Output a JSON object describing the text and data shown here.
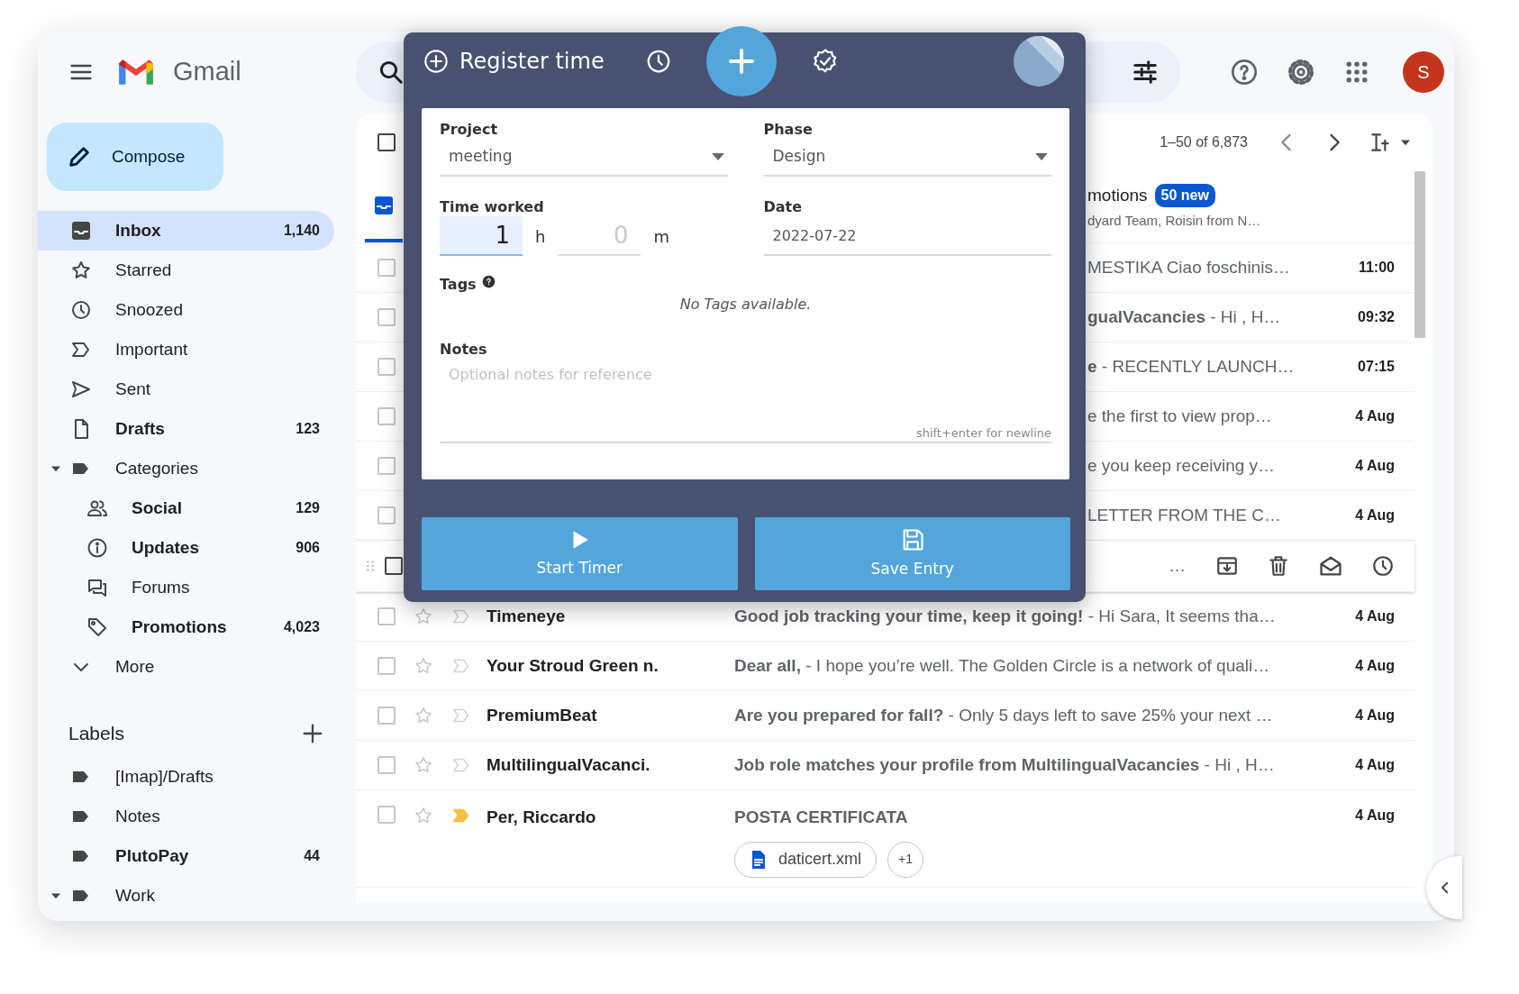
{
  "header": {
    "app_name": "Gmail",
    "avatar_initial": "S"
  },
  "sidebar": {
    "compose": "Compose",
    "items": [
      {
        "label": "Inbox",
        "count": "1,140",
        "unread": true,
        "selected": true
      },
      {
        "label": "Starred",
        "unread": false,
        "selected": false
      },
      {
        "label": "Snoozed",
        "unread": false,
        "selected": false
      },
      {
        "label": "Important",
        "unread": false,
        "selected": false
      },
      {
        "label": "Sent",
        "unread": false,
        "selected": false
      },
      {
        "label": "Drafts",
        "count": "123",
        "unread": true,
        "selected": false
      },
      {
        "label": "Categories",
        "unread": false,
        "selected": false,
        "expanded": true,
        "children": [
          {
            "label": "Social",
            "count": "129",
            "unread": true,
            "selected": false
          },
          {
            "label": "Updates",
            "count": "906",
            "unread": true,
            "selected": false
          },
          {
            "label": "Forums",
            "unread": false,
            "selected": false
          },
          {
            "label": "Promotions",
            "count": "4,023",
            "unread": true,
            "selected": false
          }
        ]
      },
      {
        "label": "More",
        "unread": false,
        "selected": false
      }
    ],
    "labels_title": "Labels",
    "labels": [
      {
        "label": "[Imap]/Drafts",
        "unread": false,
        "selected": false
      },
      {
        "label": "Notes",
        "unread": false,
        "selected": false
      },
      {
        "label": "PlutoPay",
        "count": "44",
        "unread": true,
        "selected": false
      },
      {
        "label": "Work",
        "unread": false,
        "selected": false,
        "expanded": true
      }
    ]
  },
  "toolbar": {
    "select_all_checked": false,
    "range": "1–50 of 6,873"
  },
  "category_tabs": [
    {
      "selected": true
    },
    {
      "label": "motions",
      "badge": "50 new",
      "senders": "dyard Team, Roisin from N…",
      "selected": false
    }
  ],
  "rows": [
    {
      "kind": "covered",
      "checked": false,
      "preview": "MESTIKA Ciao foschinis…",
      "time": "11:00"
    },
    {
      "kind": "covered",
      "checked": false,
      "preview": "**gualVacancies** - Hi , H…",
      "time": "09:32"
    },
    {
      "kind": "covered",
      "checked": false,
      "preview": "**e** - RECENTLY LAUNCH…",
      "time": "07:15"
    },
    {
      "kind": "covered",
      "checked": false,
      "preview": "e the first to view prop…",
      "time": "4 Aug"
    },
    {
      "kind": "covered",
      "checked": false,
      "preview": "e you keep receiving y…",
      "time": "4 Aug"
    },
    {
      "kind": "covered",
      "checked": false,
      "preview": "LETTER FROM THE C…",
      "time": "4 Aug"
    },
    {
      "kind": "hover",
      "checked": false,
      "preview": "…"
    },
    {
      "kind": "full",
      "checked": false,
      "starred": false,
      "important": false,
      "sender": "Timeneye",
      "preview": "**Good job tracking your time, keep it going!** - Hi Sara, It seems tha…",
      "time": "4 Aug"
    },
    {
      "kind": "full",
      "checked": false,
      "starred": false,
      "important": false,
      "sender": "Your Stroud Green n.",
      "preview": "**Dear all,** - I hope you’re well. The Golden Circle is a network of quali…",
      "time": "4 Aug"
    },
    {
      "kind": "full",
      "checked": false,
      "starred": false,
      "important": false,
      "sender": "PremiumBeat",
      "preview": "**Are you prepared for fall?** - Only 5 days left to save 25% your next …",
      "time": "4 Aug"
    },
    {
      "kind": "full",
      "checked": false,
      "starred": false,
      "important": false,
      "sender": "MultilingualVacanci.",
      "preview": "**Job role matches your profile from MultilingualVacancies** - Hi , H…",
      "time": "4 Aug"
    },
    {
      "kind": "full",
      "checked": false,
      "starred": false,
      "important": true,
      "sender": "Per, Riccardo",
      "preview": "**POSTA CERTIFICATA**",
      "time": "4 Aug",
      "attachments": [
        "daticert.xml"
      ],
      "more_attachments": "+1"
    }
  ],
  "popup": {
    "title": "Register time",
    "tabs": [
      {
        "selected": false
      },
      {
        "selected": true
      },
      {
        "selected": false
      }
    ],
    "project": {
      "label": "Project",
      "value": "meeting"
    },
    "phase": {
      "label": "Phase",
      "value": "Design"
    },
    "time_worked": {
      "label": "Time worked",
      "hours": "1",
      "hours_focused": true,
      "hours_unit": "h",
      "minutes_placeholder": "0",
      "minutes_unit": "m"
    },
    "date": {
      "label": "Date",
      "value": "2022-07-22"
    },
    "tags": {
      "label": "Tags",
      "empty_text": "No Tags available."
    },
    "notes": {
      "label": "Notes",
      "placeholder": "Optional notes for reference",
      "hint": "shift+enter for newline"
    },
    "buttons": [
      {
        "kind": "start",
        "label": "Start Timer"
      },
      {
        "kind": "save",
        "label": "Save Entry"
      }
    ]
  }
}
